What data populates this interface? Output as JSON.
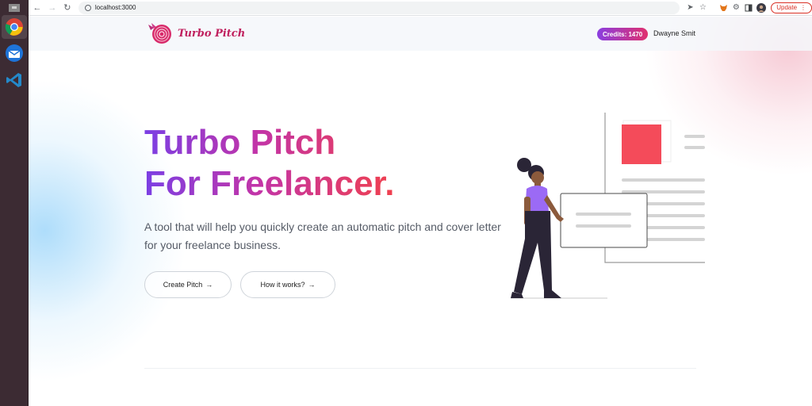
{
  "browser": {
    "url": "localhost:3000",
    "update_label": "Update"
  },
  "header": {
    "brand": "Turbo Pitch",
    "credits": "Credits: 1470",
    "user": "Dwayne Smit"
  },
  "hero": {
    "title_line1": "Turbo Pitch",
    "title_line2": "For Freelancer.",
    "description": "A tool that will help you quickly create an automatic pitch and cover letter for your freelance business."
  },
  "actions": {
    "create_label": "Create Pitch",
    "how_label": "How it works?"
  },
  "colors": {
    "brand_pink": "#c0205e",
    "gradient_purple": "#7b3fe4",
    "gradient_red": "#f0404e",
    "illustration_accent": "#f44b5a",
    "illustration_shirt": "#9b6af5"
  },
  "icons": {
    "dock": [
      "chrome-icon",
      "thunderbird-icon",
      "vscode-icon"
    ],
    "toolbar": [
      "send-icon",
      "star-icon",
      "metamask-icon",
      "extensions-icon",
      "sidepanel-icon",
      "profile-avatar"
    ]
  }
}
